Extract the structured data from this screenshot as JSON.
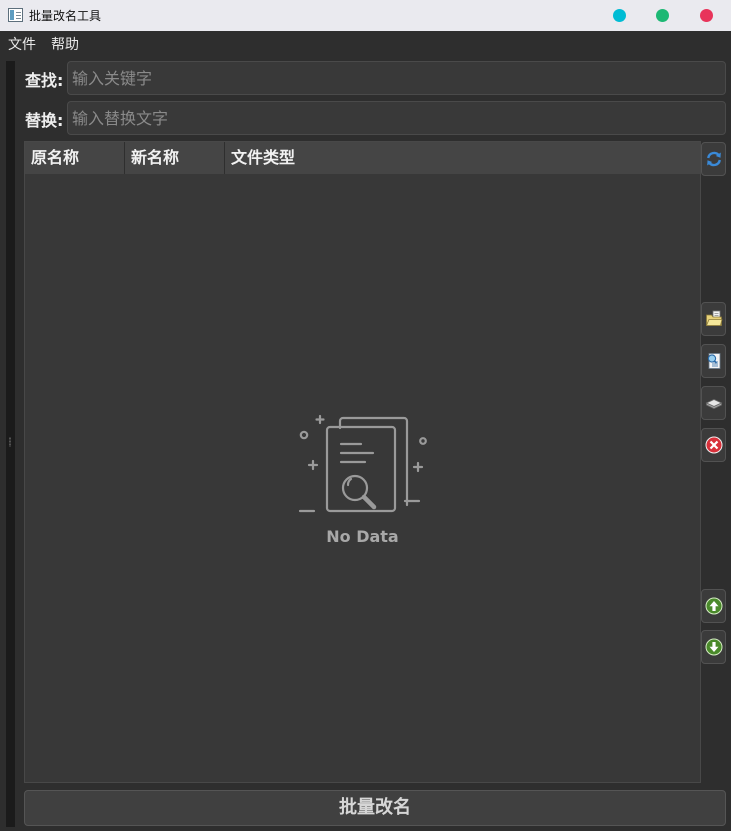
{
  "window": {
    "title": "批量改名工具",
    "controls": [
      {
        "name": "minimize",
        "color": "#00bcd4"
      },
      {
        "name": "maximize",
        "color": "#1db874"
      },
      {
        "name": "close",
        "color": "#e8345a"
      }
    ]
  },
  "menu": {
    "file": "文件",
    "help": "帮助"
  },
  "search": {
    "label": "查找:",
    "placeholder": "输入关键字",
    "value": ""
  },
  "replace": {
    "label": "替换:",
    "placeholder": "输入替换文字",
    "value": ""
  },
  "table": {
    "columns": [
      "原名称",
      "新名称",
      "文件类型"
    ],
    "rows": [],
    "empty_text": "No Data"
  },
  "side_toolbar": {
    "icons": [
      "refresh-icon",
      "open-folder-icon",
      "add-files-icon",
      "clear-icon",
      "remove-icon",
      "move-up-icon",
      "move-down-icon"
    ]
  },
  "actions": {
    "batch_rename": "批量改名"
  },
  "colors": {
    "background": "#2e2e2e",
    "table_bg": "#383838",
    "header_bg": "#454545",
    "move_arrows": "#4a8a2a",
    "remove_red": "#d8303a",
    "refresh_blue": "#3a8ad8"
  }
}
